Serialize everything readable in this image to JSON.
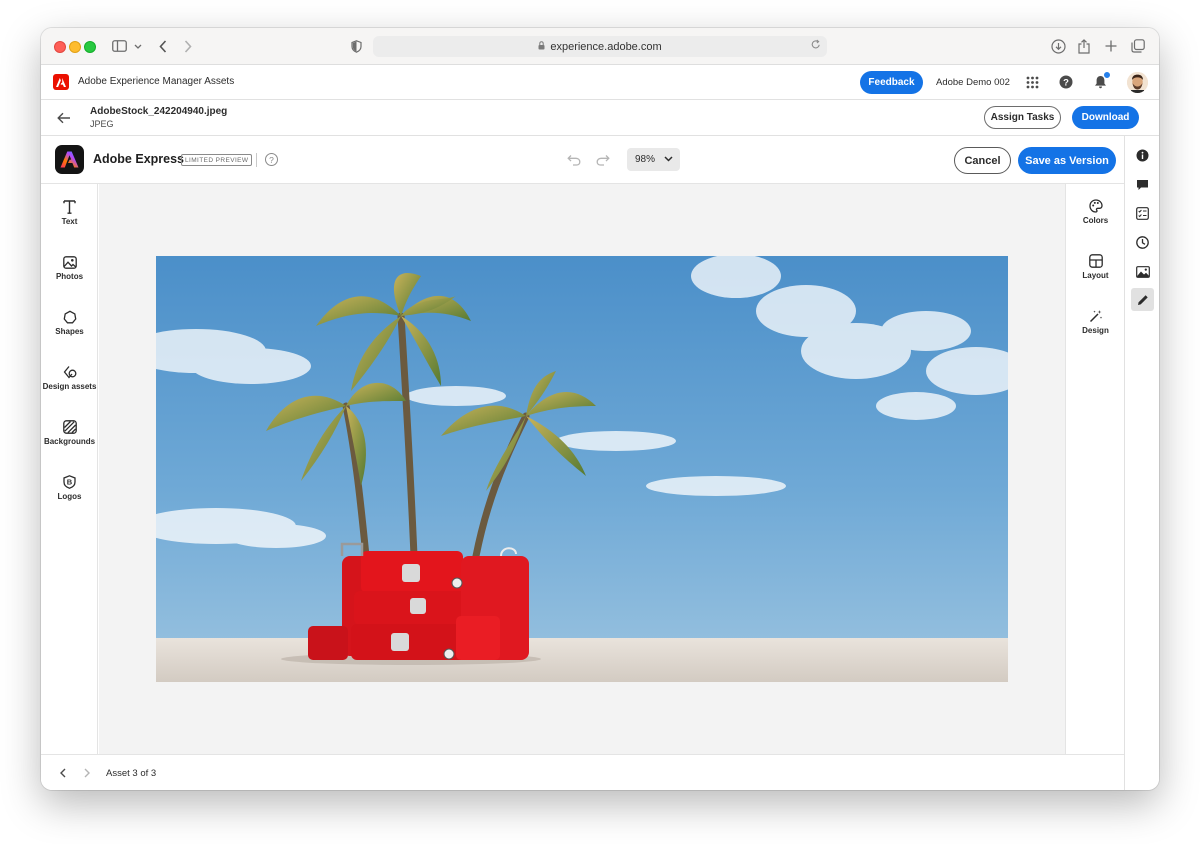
{
  "browser": {
    "url": "experience.adobe.com",
    "icons": [
      "sidebar-icon",
      "chevron-down-icon",
      "back-icon",
      "forward-icon",
      "shield-icon",
      "lock-icon",
      "reload-icon",
      "download-icon",
      "share-icon",
      "new-tab-icon",
      "tabs-icon"
    ]
  },
  "aem_header": {
    "product": "Adobe Experience Manager Assets",
    "feedback_label": "Feedback",
    "org_name": "Adobe Demo 002"
  },
  "asset": {
    "file_name": "AdobeStock_242204940.jpeg",
    "file_type": "JPEG",
    "assign_tasks_label": "Assign Tasks",
    "download_label": "Download"
  },
  "express": {
    "title": "Adobe Express",
    "badge": "LIMITED PREVIEW",
    "zoom": "98%",
    "cancel_label": "Cancel",
    "save_label": "Save as Version",
    "left_tools": [
      {
        "label": "Text",
        "icon": "text-icon"
      },
      {
        "label": "Photos",
        "icon": "photos-icon"
      },
      {
        "label": "Shapes",
        "icon": "shapes-icon"
      },
      {
        "label": "Design assets",
        "icon": "design-assets-icon"
      },
      {
        "label": "Backgrounds",
        "icon": "backgrounds-icon"
      },
      {
        "label": "Logos",
        "icon": "logos-icon"
      }
    ],
    "right_tools": [
      {
        "label": "Colors",
        "icon": "palette-icon"
      },
      {
        "label": "Layout",
        "icon": "layout-icon"
      },
      {
        "label": "Design",
        "icon": "magic-wand-icon"
      }
    ]
  },
  "pager": {
    "text": "Asset 3 of 3"
  },
  "aem_rail": [
    "info-icon",
    "comment-icon",
    "tasks-icon",
    "history-icon",
    "renditions-icon",
    "edit-icon"
  ],
  "colors": {
    "accent": "#1473e6",
    "adobe_red": "#eb1000"
  }
}
